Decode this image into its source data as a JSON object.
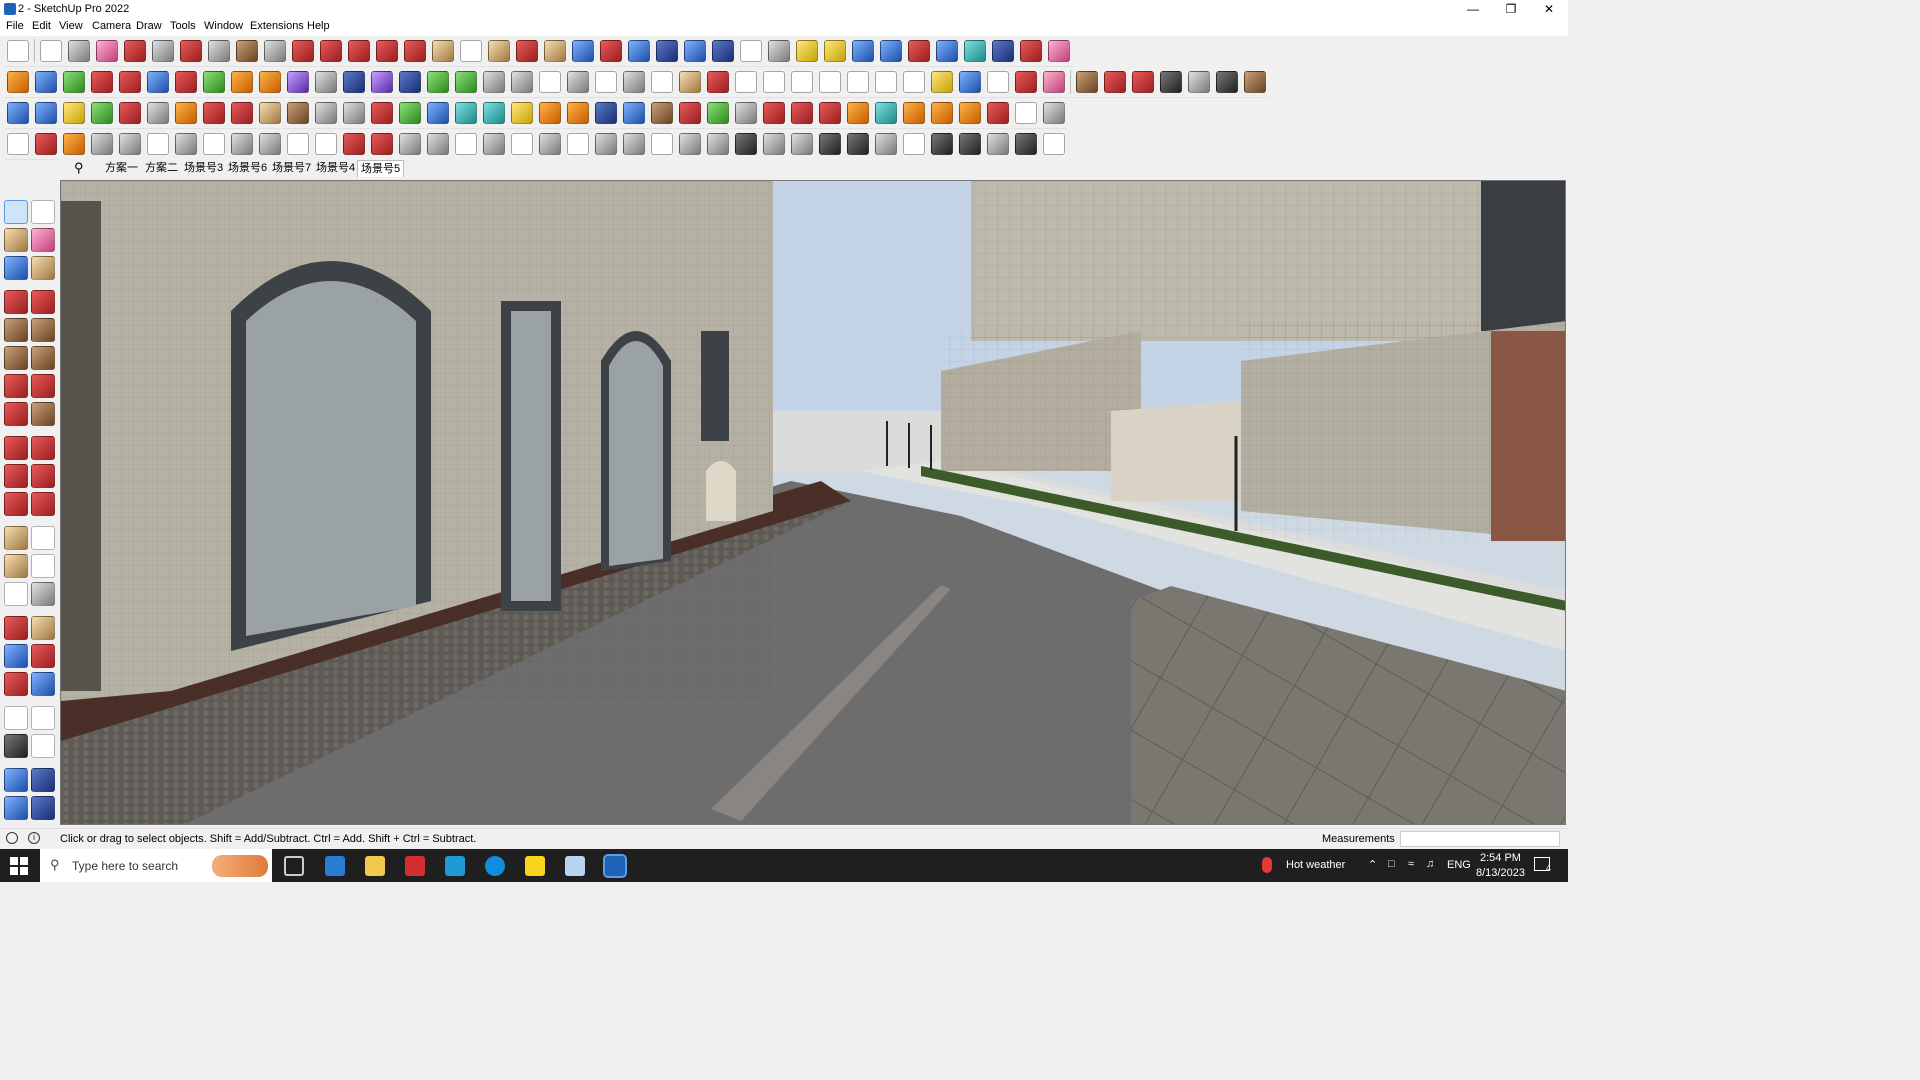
{
  "window": {
    "title": "2 - SketchUp Pro 2022"
  },
  "menu": [
    "File",
    "Edit",
    "View",
    "Camera",
    "Draw",
    "Tools",
    "Window",
    "Extensions",
    "Help"
  ],
  "scenes": {
    "tabs": [
      "方案一",
      "方案二",
      "场景号3",
      "场景号6",
      "场景号7",
      "场景号4",
      "场景号5"
    ],
    "active_index": 6
  },
  "status": {
    "message": "Click or drag to select objects. Shift = Add/Subtract. Ctrl = Add. Shift + Ctrl = Subtract.",
    "measurements_label": "Measurements",
    "measurements_value": ""
  },
  "taskbar": {
    "search_placeholder": "Type here to search",
    "weather": "Hot weather",
    "language": "ENG",
    "time": "2:54 PM",
    "date": "8/13/2023",
    "notification_count": "4"
  },
  "colors": {
    "taskbar": "#1f1f1f",
    "accent": "#1e63b5"
  }
}
